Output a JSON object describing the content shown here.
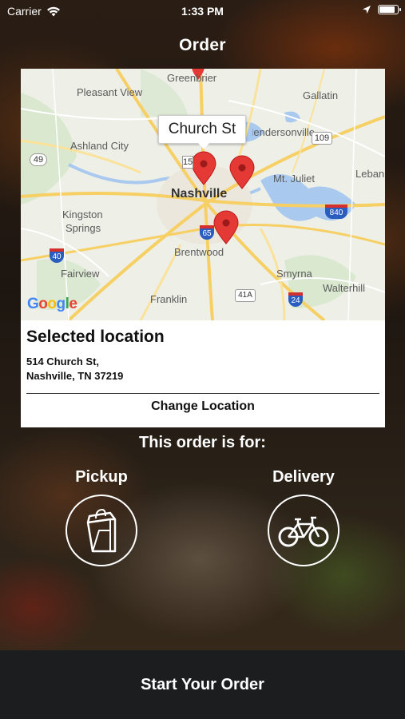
{
  "status_bar": {
    "carrier": "Carrier",
    "time": "1:33 PM",
    "icons": [
      "wifi-icon",
      "location-arrow-icon",
      "battery-icon"
    ]
  },
  "header": {
    "title": "Order"
  },
  "map": {
    "callout": "Church St",
    "labels": {
      "greenbrier": "Greenbrier",
      "pleasant_view": "Pleasant View",
      "gallatin": "Gallatin",
      "ashland_city": "Ashland City",
      "hendersonville": "Hendersonville",
      "nashville": "Nashville",
      "mt_juliet": "Mt. Juliet",
      "lebanon": "Leban",
      "kingston_springs_1": "Kingston",
      "kingston_springs_2": "Springs",
      "brentwood": "Brentwood",
      "fairview": "Fairview",
      "smyrna": "Smyrna",
      "walterhill": "Walterhill",
      "franklin": "Franklin"
    },
    "shields": {
      "r49": "49",
      "r109": "109",
      "r155": "155",
      "r40": "40",
      "r65": "65",
      "r840": "840",
      "r41a": "41A",
      "r24": "24"
    },
    "attribution": "Google",
    "pin_color": "#e53935"
  },
  "location": {
    "heading": "Selected location",
    "address_line1": "514 Church St,",
    "address_line2": "Nashville, TN 37219",
    "change_label": "Change Location"
  },
  "order_type": {
    "prompt": "This order is for:",
    "pickup_label": "Pickup",
    "delivery_label": "Delivery"
  },
  "footer": {
    "start_label": "Start Your Order"
  }
}
